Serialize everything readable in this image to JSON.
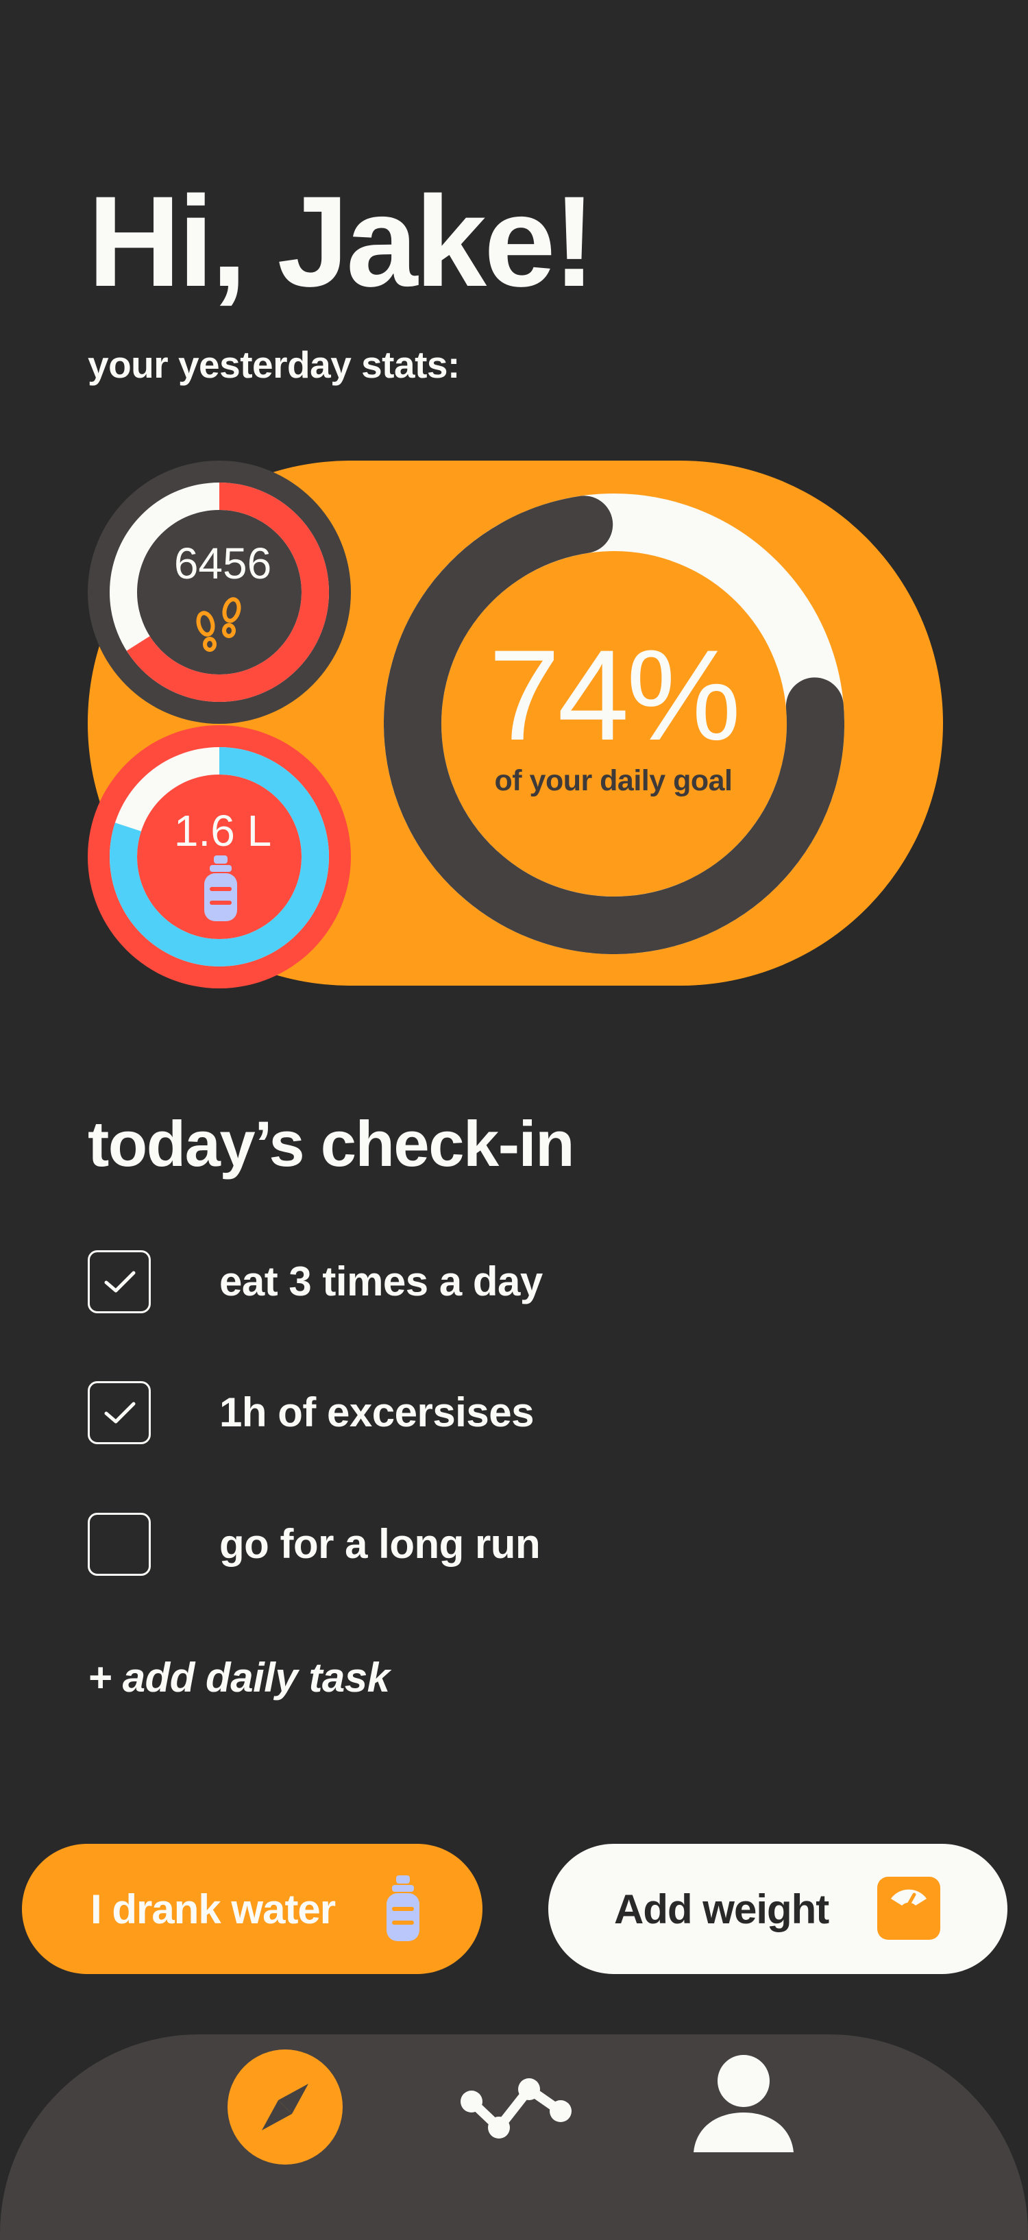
{
  "header": {
    "greeting": "Hi, Jake!",
    "subtitle": "your yesterday stats:"
  },
  "stats": {
    "steps": {
      "value": "6456",
      "progress": 0.66,
      "icon": "footprints-icon"
    },
    "water": {
      "value": "1.6 L",
      "progress": 0.8,
      "icon": "water-bottle-icon"
    },
    "daily_goal": {
      "percent_label": "74%",
      "caption": "of your daily goal",
      "progress": 0.74
    }
  },
  "checkin": {
    "title": "today’s check-in",
    "tasks": [
      {
        "label": "eat 3 times a day",
        "checked": true
      },
      {
        "label": "1h of excersises",
        "checked": true
      },
      {
        "label": "go for a long run",
        "checked": false
      }
    ],
    "add_task_label": "+ add daily task"
  },
  "actions": {
    "water_button": {
      "label": "I drank water",
      "icon": "water-bottle-icon"
    },
    "weight_button": {
      "label": "Add weight",
      "icon": "scale-icon"
    }
  },
  "nav": {
    "items": [
      {
        "icon": "compass-icon",
        "active": true
      },
      {
        "icon": "chart-line-icon",
        "active": false
      },
      {
        "icon": "profile-icon",
        "active": false
      }
    ]
  },
  "colors": {
    "background": "#292929",
    "accent_orange": "#FF9D1B",
    "accent_red": "#FF4B3E",
    "accent_blue": "#4FD0F9",
    "dark_ring": "#444140",
    "light": "#FAFAF7",
    "bottle_lavender": "#B9C7FA"
  }
}
